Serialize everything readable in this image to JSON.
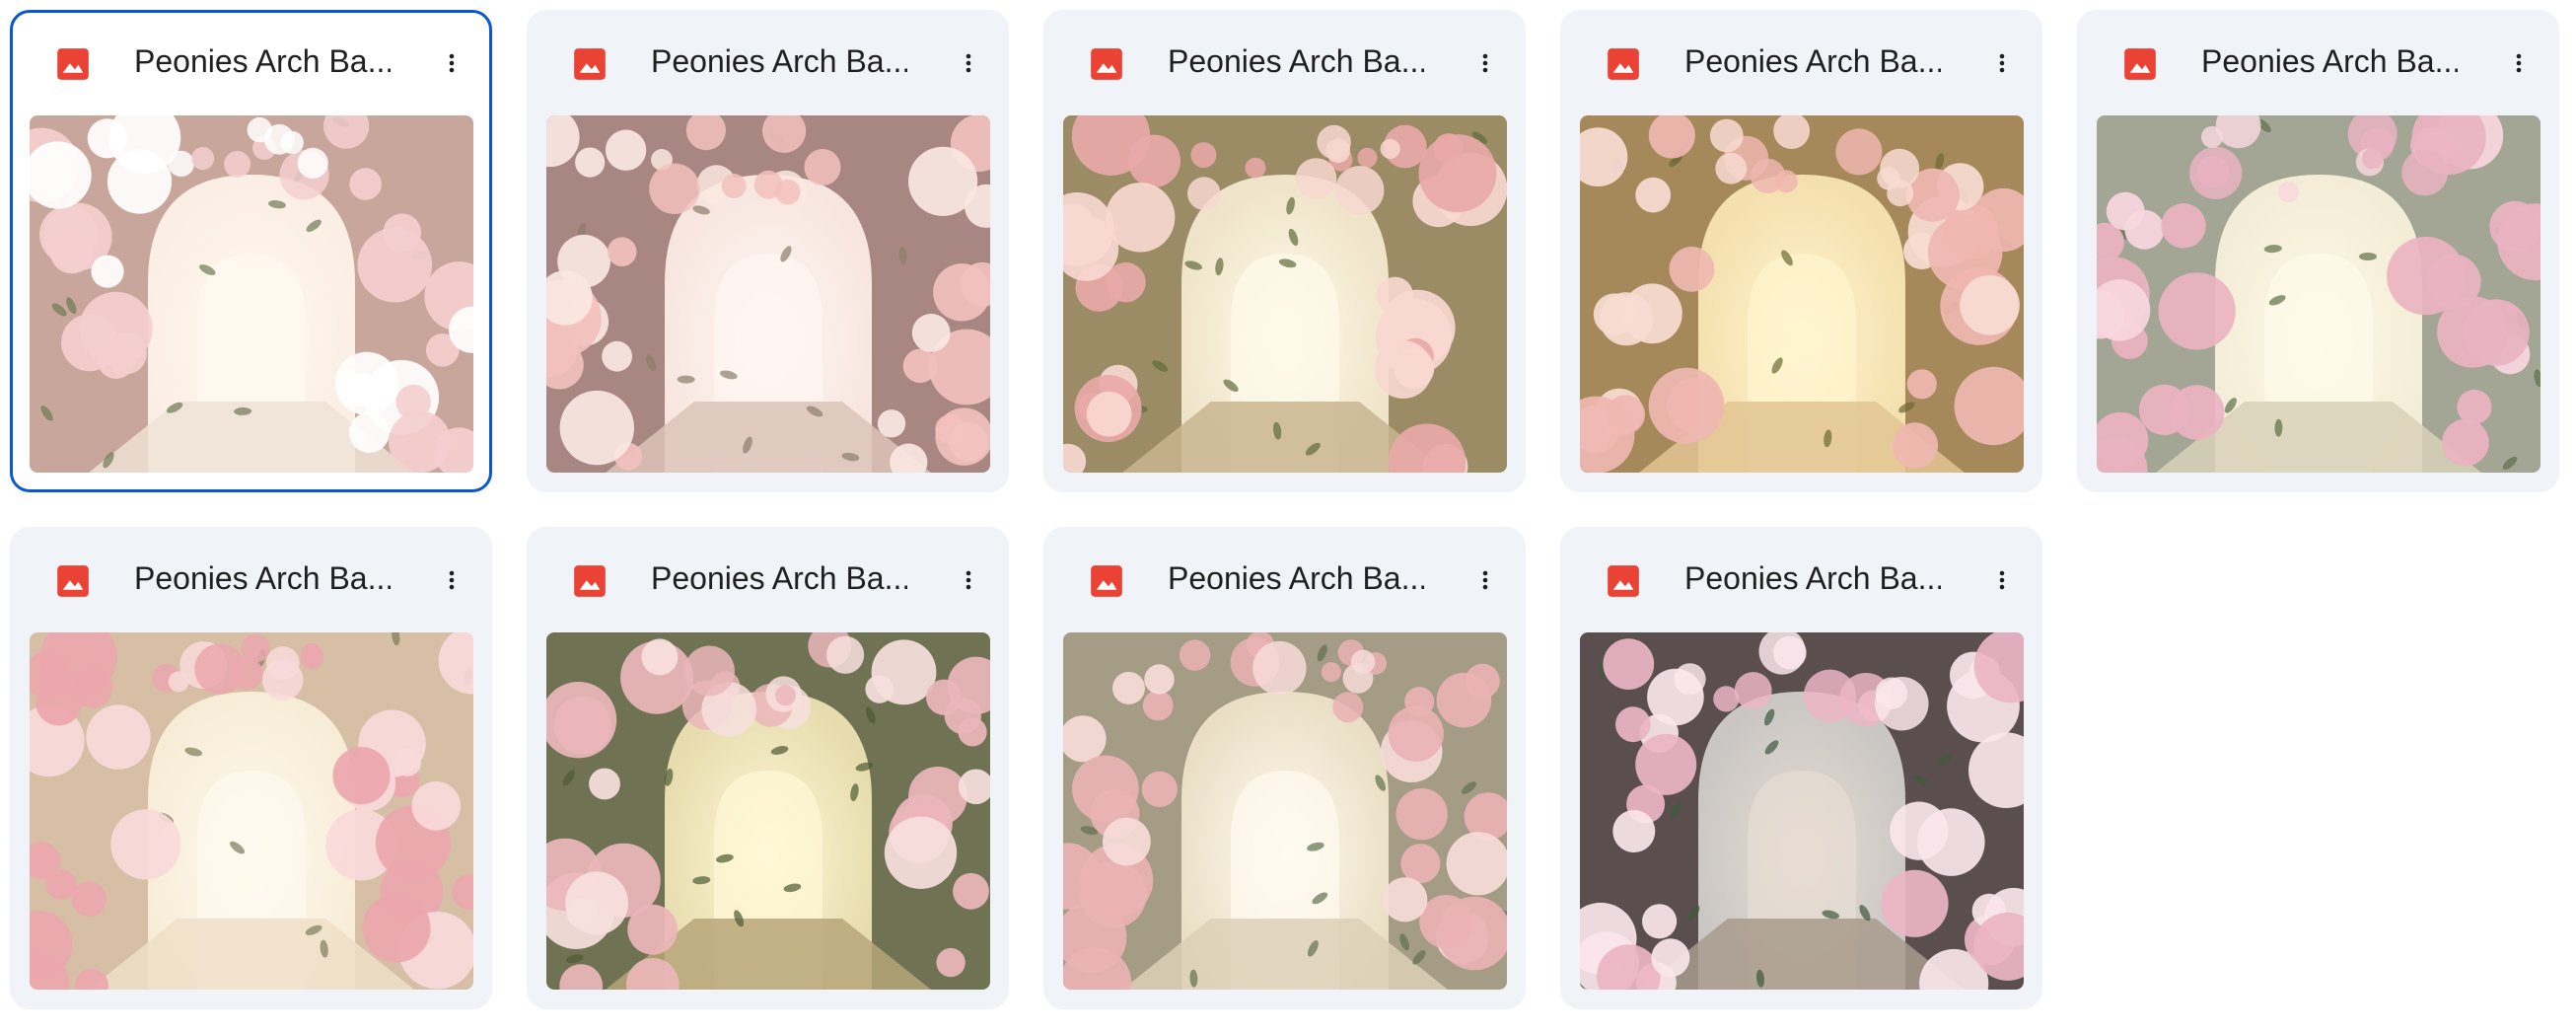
{
  "colors": {
    "accent": "#0b57d0",
    "card_background": "#f0f4f9",
    "image_icon": "#ea4335"
  },
  "files": [
    {
      "title": "Peonies Arch Ba...",
      "icon": "image-file-icon",
      "menu_icon": "more-vert-icon",
      "selected": true,
      "thumbnail": {
        "sky": "#fbeee4",
        "glow": "#fff9ef",
        "wall": "#c9a69b",
        "floor": "#efe2d6",
        "flower_a": "#f4cfcf",
        "flower_b": "#ffffff",
        "leaf": "#6e7a55"
      }
    },
    {
      "title": "Peonies Arch Ba...",
      "icon": "image-file-icon",
      "menu_icon": "more-vert-icon",
      "selected": false,
      "thumbnail": {
        "sky": "#f7e6df",
        "glow": "#fff6f2",
        "wall": "#a88783",
        "floor": "#dcc3b8",
        "flower_a": "#f2c1bd",
        "flower_b": "#fbe7e2",
        "leaf": "#8a7d6a"
      }
    },
    {
      "title": "Peonies Arch Ba...",
      "icon": "image-file-icon",
      "menu_icon": "more-vert-icon",
      "selected": false,
      "thumbnail": {
        "sky": "#efe3c9",
        "glow": "#fffbe9",
        "wall": "#9b8c66",
        "floor": "#c9b58f",
        "flower_a": "#e9a9a8",
        "flower_b": "#f8d8d0",
        "leaf": "#5f6b3a"
      }
    },
    {
      "title": "Peonies Arch Ba...",
      "icon": "image-file-icon",
      "menu_icon": "more-vert-icon",
      "selected": false,
      "thumbnail": {
        "sky": "#f4dfae",
        "glow": "#fff5cf",
        "wall": "#a6895a",
        "floor": "#e2c693",
        "flower_a": "#efb7b1",
        "flower_b": "#f8dcd2",
        "leaf": "#6b6a34"
      }
    },
    {
      "title": "Peonies Arch Ba...",
      "icon": "image-file-icon",
      "menu_icon": "more-vert-icon",
      "selected": false,
      "thumbnail": {
        "sky": "#f3ecd6",
        "glow": "#fffbe8",
        "wall": "#a3a695",
        "floor": "#d8d1b8",
        "flower_a": "#eab3c1",
        "flower_b": "#f8d7de",
        "leaf": "#5c7048"
      }
    },
    {
      "title": "Peonies Arch Ba...",
      "icon": "image-file-icon",
      "menu_icon": "more-vert-icon",
      "selected": false,
      "thumbnail": {
        "sky": "#f7ecd6",
        "glow": "#fffaf0",
        "wall": "#d7bfa6",
        "floor": "#efdfc8",
        "flower_a": "#eba7ae",
        "flower_b": "#f9dada",
        "leaf": "#7c7d5a"
      }
    },
    {
      "title": "Peonies Arch Ba...",
      "icon": "image-file-icon",
      "menu_icon": "more-vert-icon",
      "selected": false,
      "thumbnail": {
        "sky": "#e6dcae",
        "glow": "#fff8d6",
        "wall": "#6f7354",
        "floor": "#b7a679",
        "flower_a": "#ebb6ba",
        "flower_b": "#f7e0de",
        "leaf": "#4d5a32"
      }
    },
    {
      "title": "Peonies Arch Ba...",
      "icon": "image-file-icon",
      "menu_icon": "more-vert-icon",
      "selected": false,
      "thumbnail": {
        "sky": "#eadfc6",
        "glow": "#fffbef",
        "wall": "#a59c86",
        "floor": "#ddd0b8",
        "flower_a": "#eab3b4",
        "flower_b": "#f7dcd9",
        "leaf": "#607050"
      }
    },
    {
      "title": "Peonies Arch Ba...",
      "icon": "image-file-icon",
      "menu_icon": "more-vert-icon",
      "selected": false,
      "thumbnail": {
        "sky": "#c9c6c3",
        "glow": "#e7ddd3",
        "wall": "#5b4e4e",
        "floor": "#a89b8d",
        "flower_a": "#ecb5c6",
        "flower_b": "#fae6ec",
        "leaf": "#3f5a3c"
      }
    }
  ]
}
